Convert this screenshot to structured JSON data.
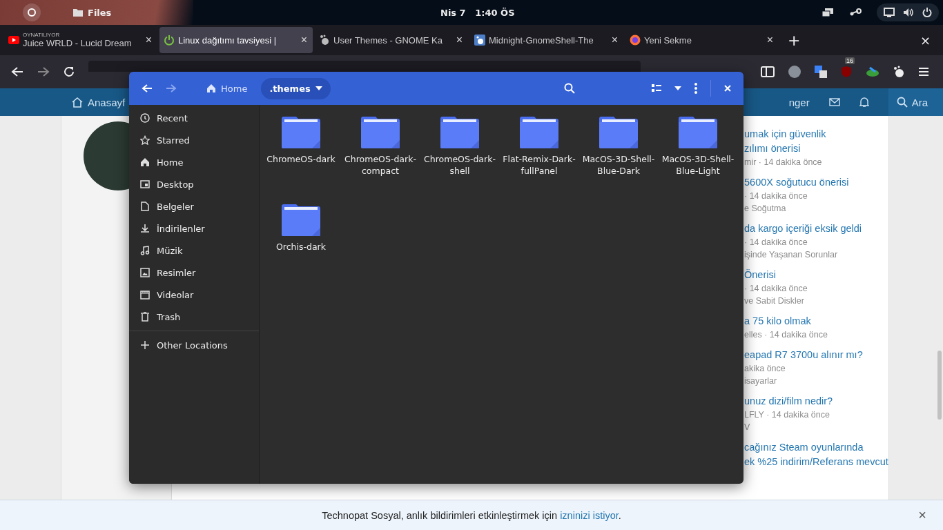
{
  "top_bar": {
    "app": "Files",
    "clock": "Nis 7   1:40 ÖS"
  },
  "tabs": [
    {
      "label": "Juice WRLD - Lucid Dream",
      "sub": "OYNATILIYOR",
      "selected": false,
      "close": "×"
    },
    {
      "label": "Linux dağıtımı tavsiyesi |",
      "selected": true,
      "close": "×"
    },
    {
      "label": "User Themes - GNOME Ka",
      "selected": false,
      "close": "×"
    },
    {
      "label": "Midnight-GnomeShell-The",
      "selected": false,
      "close": "×"
    },
    {
      "label": "Yeni Sekme",
      "selected": false,
      "close": "×"
    }
  ],
  "tab_actions": {
    "new_tab": "+",
    "close_window": "×"
  },
  "toolbar": {
    "badge": "16"
  },
  "site_nav": {
    "home": "Anasayf",
    "messenger": "nger",
    "search": "Ara"
  },
  "sidebar_posts": [
    {
      "title_lines": [
        "umak için güvenlik",
        "zılımı önerisi"
      ],
      "meta": [
        "mir · 14 dakika önce"
      ]
    },
    {
      "title_lines": [
        "5600X soğutucu önerisi"
      ],
      "meta": [
        "· 14 dakika önce",
        "e Soğutma"
      ]
    },
    {
      "title_lines": [
        "da kargo içeriği eksik geldi"
      ],
      "meta": [
        "· 14 dakika önce",
        "işinde Yaşanan Sorunlar"
      ]
    },
    {
      "title_lines": [
        "Önerisi"
      ],
      "meta": [
        "· 14 dakika önce",
        "ve Sabit Diskler"
      ]
    },
    {
      "title_lines": [
        "a 75 kilo olmak"
      ],
      "meta": [
        "elles · 14 dakika önce"
      ]
    },
    {
      "title_lines": [
        "eapad R7 3700u alınır mı?"
      ],
      "meta": [
        "akika önce",
        "isayarlar"
      ]
    },
    {
      "title_lines": [
        "unuz dizi/film nedir?"
      ],
      "meta": [
        "LFLY · 14 dakika önce",
        "V"
      ]
    },
    {
      "title_lines": [
        "cağınız Steam oyunlarında",
        "ek %25 indirim/Referans mevcut"
      ]
    }
  ],
  "notification": {
    "before": "Technopat Sosyal, anlık bildirimleri etkinleştirmek için ",
    "link": "izninizi istiyor",
    "after": ".",
    "close": "×"
  },
  "files_window": {
    "path": [
      {
        "label": "Home",
        "kind": "home",
        "selected": false
      },
      {
        "label": ".themes",
        "kind": "folder",
        "selected": true
      }
    ],
    "sidebar": [
      {
        "label": "Recent",
        "kind": "recent"
      },
      {
        "label": "Starred",
        "kind": "starred"
      },
      {
        "label": "Home",
        "kind": "home"
      },
      {
        "label": "Desktop",
        "kind": "desktop"
      },
      {
        "label": "Belgeler",
        "kind": "documents"
      },
      {
        "label": "İndirilenler",
        "kind": "downloads"
      },
      {
        "label": "Müzik",
        "kind": "music"
      },
      {
        "label": "Resimler",
        "kind": "pictures"
      },
      {
        "label": "Videolar",
        "kind": "videos"
      },
      {
        "label": "Trash",
        "kind": "trash"
      }
    ],
    "other_locations": "Other Locations",
    "folders": [
      "ChromeOS-dark",
      "ChromeOS-dark-compact",
      "ChromeOS-dark-shell",
      "Flat-Remix-Dark-fullPanel",
      "MacOS-3D-Shell-Blue-Dark",
      "MacOS-3D-Shell-Blue-Light",
      "Orchis-dark"
    ]
  }
}
